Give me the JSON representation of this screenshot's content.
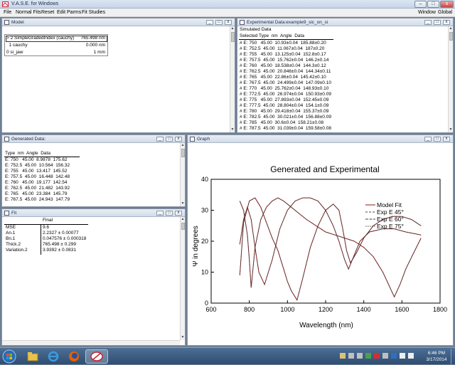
{
  "app": {
    "title": "V.A.S.E. for Windows",
    "min": "–",
    "max": "□",
    "close": "x"
  },
  "menu": {
    "left": [
      "File",
      "Normal Fits",
      "Reset",
      "Edit Parms",
      "Fit Studies"
    ],
    "right": [
      "Window",
      "Global"
    ]
  },
  "model": {
    "title": "Model",
    "layers": [
      {
        "label": "> 2 SimpleGradedIndex (cauchy)",
        "value": "765.498 nm"
      },
      {
        "label": "  1 cauchy",
        "value": "0.000 nm"
      },
      {
        "label": "0 si_jaw",
        "value": "1 mm"
      }
    ]
  },
  "experimental": {
    "title": "Experimental Data:example9_sic_on_si",
    "line1": "Simulated Data",
    "header": "Selected Type  nm  Angle  Data",
    "rows": [
      "# E: 750   45.00  10.93±0.04  185.88±0.20",
      "# E: 752.5  45.00  11.067±0.04  187±0.20",
      "# E: 755   45.00  13.125±0.04  152.8±0.17",
      "# E: 757.5  45.00  15.762±0.04  146.2±0.14",
      "# E: 760   45.00  18.538±0.04  144.3±0.12",
      "# E: 762.5  45.00  20.846±0.04  144.34±0.11",
      "# E: 765   45.00  22.86±0.04  145.42±0.10",
      "# E: 767.5  45.00  24.499±0.04  147.09±0.10",
      "# E: 770   45.00  25.762±0.04  148.93±0.10",
      "# E: 772.5  45.00  26.974±0.04  150.93±0.09",
      "# E: 775   45.00  27.893±0.04  152.45±0.09",
      "# E: 777.5  45.00  28.804±0.04  154.1±0.09",
      "# E: 780   45.00  29.418±0.04  155.37±0.09",
      "# E: 782.5  45.00  30.021±0.04  156.88±0.09",
      "# E: 785   45.00  30.6±0.04  158.21±0.08",
      "# E: 787.5  45.00  31.039±0.04  159.58±0.08"
    ]
  },
  "generated": {
    "title": "Generated Data:",
    "header": "Type  nm  Angle  Data",
    "rows": [
      "E: 750   45.00  8.9878  175.62",
      "E: 752.5  45.00  10.564  156.32",
      "E: 755   45.00  13.417  145.52",
      "E: 757.5  45.00  16.448  142.48",
      "E: 760   45.00  19.177  142.54",
      "E: 762.5  45.00  21.482  143.92",
      "E: 765   45.00  23.384  145.79",
      "E: 767.5  45.00  24.943  147.79"
    ]
  },
  "fit": {
    "title": "Fit",
    "col_header": "Final",
    "rows": [
      {
        "name": "MSE",
        "value": "9.6"
      },
      {
        "name": "An.1",
        "value": "2.2327 ± 0.00077"
      },
      {
        "name": "Bn.1",
        "value": "0.047576 ± 0.000318"
      },
      {
        "name": "Thick.2",
        "value": "765.498 ± 0.299"
      },
      {
        "name": "Variation.2",
        "value": "3.9392 ± 0.0831"
      }
    ]
  },
  "graph": {
    "title": "Graph",
    "legend": [
      "Model Fit",
      "Exp E 45°",
      "Exp E 60°",
      "Exp E 75°"
    ],
    "colors": {
      "model": "#8b1a1a",
      "exp": "#444444"
    }
  },
  "chart_data": {
    "type": "line",
    "title": "Generated and Experimental",
    "xlabel": "Wavelength (nm)",
    "ylabel": "Ψ in degrees",
    "xlim": [
      600,
      1800
    ],
    "ylim": [
      0,
      40
    ],
    "xticks": [
      600,
      800,
      1000,
      1200,
      1400,
      1600,
      1800
    ],
    "yticks": [
      0,
      10,
      20,
      30,
      40
    ],
    "grid": false,
    "legend_position": "top-right",
    "series": [
      {
        "name": "Exp E 45°",
        "x": [
          750,
          770,
          800,
          830,
          860,
          890,
          920,
          950,
          980,
          1000,
          1020,
          1050,
          1080,
          1120,
          1160,
          1200,
          1240,
          1270,
          1290,
          1310,
          1330,
          1360,
          1400,
          1450,
          1500,
          1550,
          1600,
          1650,
          1700
        ],
        "y": [
          9,
          26,
          33,
          34,
          31,
          26,
          21,
          17,
          11,
          7,
          4,
          1,
          8,
          18,
          25,
          30,
          32,
          30,
          24,
          17,
          13,
          16,
          21,
          25,
          27,
          28,
          28,
          27,
          25
        ]
      },
      {
        "name": "Exp E 60°",
        "x": [
          750,
          770,
          790,
          810,
          830,
          850,
          880,
          920,
          960,
          1000,
          1040,
          1080,
          1120,
          1160,
          1200,
          1240,
          1270,
          1300,
          1320,
          1340,
          1380,
          1430,
          1500,
          1560,
          1620,
          1700
        ],
        "y": [
          19,
          27,
          31,
          27,
          18,
          10,
          6,
          14,
          24,
          30,
          33,
          34,
          34,
          33,
          30,
          25,
          20,
          14,
          11,
          14,
          20,
          23,
          24,
          24,
          23,
          22
        ]
      },
      {
        "name": "Exp E 75°",
        "x": [
          750,
          770,
          790,
          800,
          810,
          830,
          860,
          890,
          920,
          950,
          980,
          1020,
          1060,
          1100,
          1150,
          1200,
          1250,
          1300,
          1350,
          1400,
          1450,
          1500,
          1530,
          1560,
          1590,
          1620,
          1660,
          1700
        ],
        "y": [
          33,
          30,
          22,
          14,
          5,
          18,
          27,
          31,
          33,
          34,
          33,
          31,
          29,
          27,
          25,
          23,
          22,
          21,
          20,
          18,
          15,
          10,
          6,
          2,
          6,
          11,
          16,
          21
        ]
      }
    ]
  }
}
